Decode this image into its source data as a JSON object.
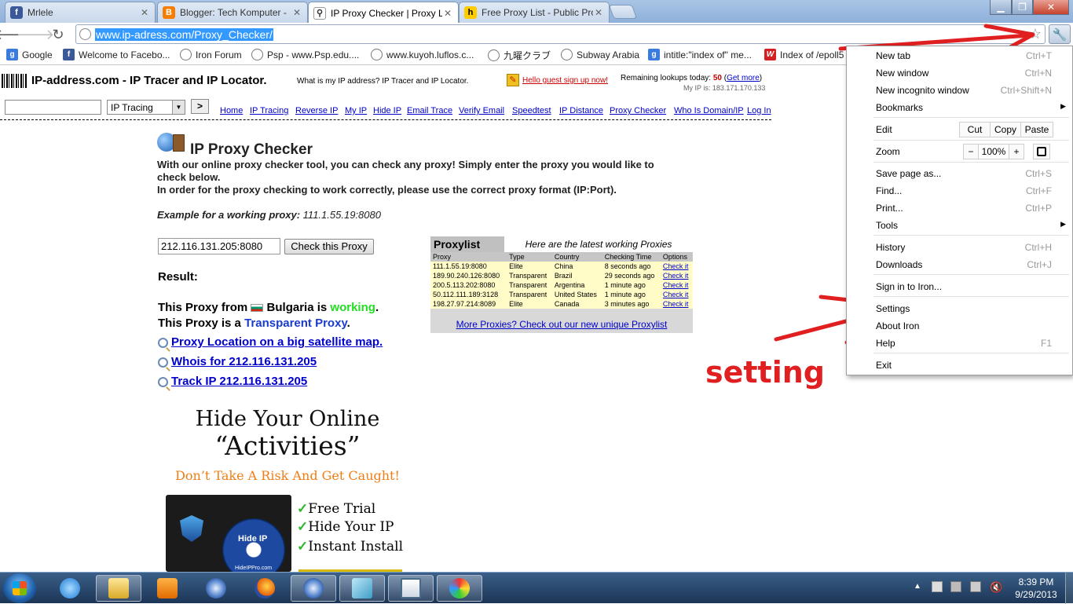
{
  "tabs": [
    {
      "label": "Mrlele",
      "favicon": "facebook-icon",
      "color": "#3b5998"
    },
    {
      "label": "Blogger: Tech Komputer - ",
      "favicon": "blogger-icon",
      "color": "#f57d00"
    },
    {
      "label": "IP Proxy Checker | Proxy Lo",
      "favicon": "page-icon",
      "color": "#ffffff"
    },
    {
      "label": "Free Proxy List - Public Pro",
      "favicon": "hidemyass-icon",
      "color": "#ffcc00"
    }
  ],
  "address": {
    "url": "www.ip-adress.com/Proxy_Checker/"
  },
  "bookmarks": [
    {
      "label": "Google",
      "icon": "google-icon"
    },
    {
      "label": "Welcome to Facebo...",
      "icon": "facebook-icon"
    },
    {
      "label": "Iron Forum",
      "icon": "globe-icon"
    },
    {
      "label": "Psp - www.Psp.edu....",
      "icon": "globe-icon"
    },
    {
      "label": "www.kuyoh.luflos.c...",
      "icon": "globe-icon"
    },
    {
      "label": "九曜クラブ",
      "icon": "globe-icon"
    },
    {
      "label": "Subway Arabia",
      "icon": "globe-icon"
    },
    {
      "label": "intitle:\"index of\" me...",
      "icon": "google-icon"
    },
    {
      "label": "Index of /epoll5",
      "icon": "w-icon"
    }
  ],
  "site": {
    "logo_text": "IP-address.com - IP Tracer and IP Locator.",
    "tagline": "What is my IP address? IP Tracer and IP Locator.",
    "signup": "Hello guest sign up now!",
    "lookups_label": "Remaining lookups today:",
    "lookups_count": "50",
    "get_more": "Get more",
    "my_ip": "My IP is: 183.171.170.133",
    "search_select": "IP Tracing",
    "go_label": ">",
    "nav": [
      "Home",
      "IP Tracing",
      "Reverse IP",
      "My IP",
      "Hide IP",
      "Email Trace",
      "Verify Email",
      "Speedtest",
      "IP Distance",
      "Proxy Checker",
      "Who Is Domain/IP",
      "Log In"
    ]
  },
  "checker": {
    "title": "IP Proxy Checker",
    "desc1": "With our online proxy checker tool, you can check any proxy! Simply enter the proxy you would like to",
    "desc2": "check below.",
    "desc3": "In order for the proxy checking to work correctly, please use the correct proxy format (IP:Port).",
    "example_label": "Example for a working proxy:",
    "example_value": "111.1.55.19:8080",
    "input_value": "212.116.131.205:8080",
    "button": "Check this Proxy",
    "result_label": "Result:",
    "line1_pre": "This Proxy from",
    "line1_country": "Bulgaria is",
    "line1_status": "working",
    "line1_post": ".",
    "line2_pre": "This Proxy is a",
    "line2_type": "Transparent Proxy",
    "line2_post": ".",
    "link1": "Proxy Location on a big satellite map.",
    "link2": "Whois for 212.116.131.205",
    "link3": "Track IP 212.116.131.205"
  },
  "proxylist": {
    "title": "Proxylist",
    "subtitle": "Here are the latest working Proxies",
    "headers": [
      "Proxy",
      "Type",
      "Country",
      "Checking Time",
      "Options"
    ],
    "rows": [
      [
        "111.1.55.19:8080",
        "Elite",
        "China",
        "8 seconds ago",
        "Check it"
      ],
      [
        "189.90.240.126:8080",
        "Transparent",
        "Brazil",
        "29 seconds ago",
        "Check it"
      ],
      [
        "200.5.113.202:8080",
        "Transparent",
        "Argentina",
        "1 minute ago",
        "Check it"
      ],
      [
        "50.112.111.189:3128",
        "Transparent",
        "United States",
        "1 minute ago",
        "Check it"
      ],
      [
        "198.27.97.214:8089",
        "Elite",
        "Canada",
        "3 minutes ago",
        "Check it"
      ]
    ],
    "more": "More Proxies? Check out our new unique Proxylist"
  },
  "ad": {
    "line1": "Hide Your Online",
    "line2": "“Activities”",
    "line3": "Don’t Take A Risk And Get Caught!",
    "feature1": "Free Trial",
    "feature2": "Hide Your IP",
    "feature3": "Instant Install",
    "box_label": "Hide IP",
    "box_url": "HideIPPro.com"
  },
  "annotation": {
    "text": "setting",
    "color": "#e02020"
  },
  "menu": {
    "new_tab": "New tab",
    "new_tab_sc": "Ctrl+T",
    "new_window": "New window",
    "new_window_sc": "Ctrl+N",
    "incognito": "New incognito window",
    "incognito_sc": "Ctrl+Shift+N",
    "bookmarks": "Bookmarks",
    "edit": "Edit",
    "cut": "Cut",
    "copy": "Copy",
    "paste": "Paste",
    "zoom": "Zoom",
    "zoom_minus": "−",
    "zoom_value": "100%",
    "zoom_plus": "+",
    "save": "Save page as...",
    "save_sc": "Ctrl+S",
    "find": "Find...",
    "find_sc": "Ctrl+F",
    "print": "Print...",
    "print_sc": "Ctrl+P",
    "tools": "Tools",
    "history": "History",
    "history_sc": "Ctrl+H",
    "downloads": "Downloads",
    "downloads_sc": "Ctrl+J",
    "signin": "Sign in to Iron...",
    "settings": "Settings",
    "about": "About Iron",
    "help": "Help",
    "help_sc": "F1",
    "exit": "Exit"
  },
  "taskbar": {
    "time": "8:39 PM",
    "date": "9/29/2013"
  }
}
